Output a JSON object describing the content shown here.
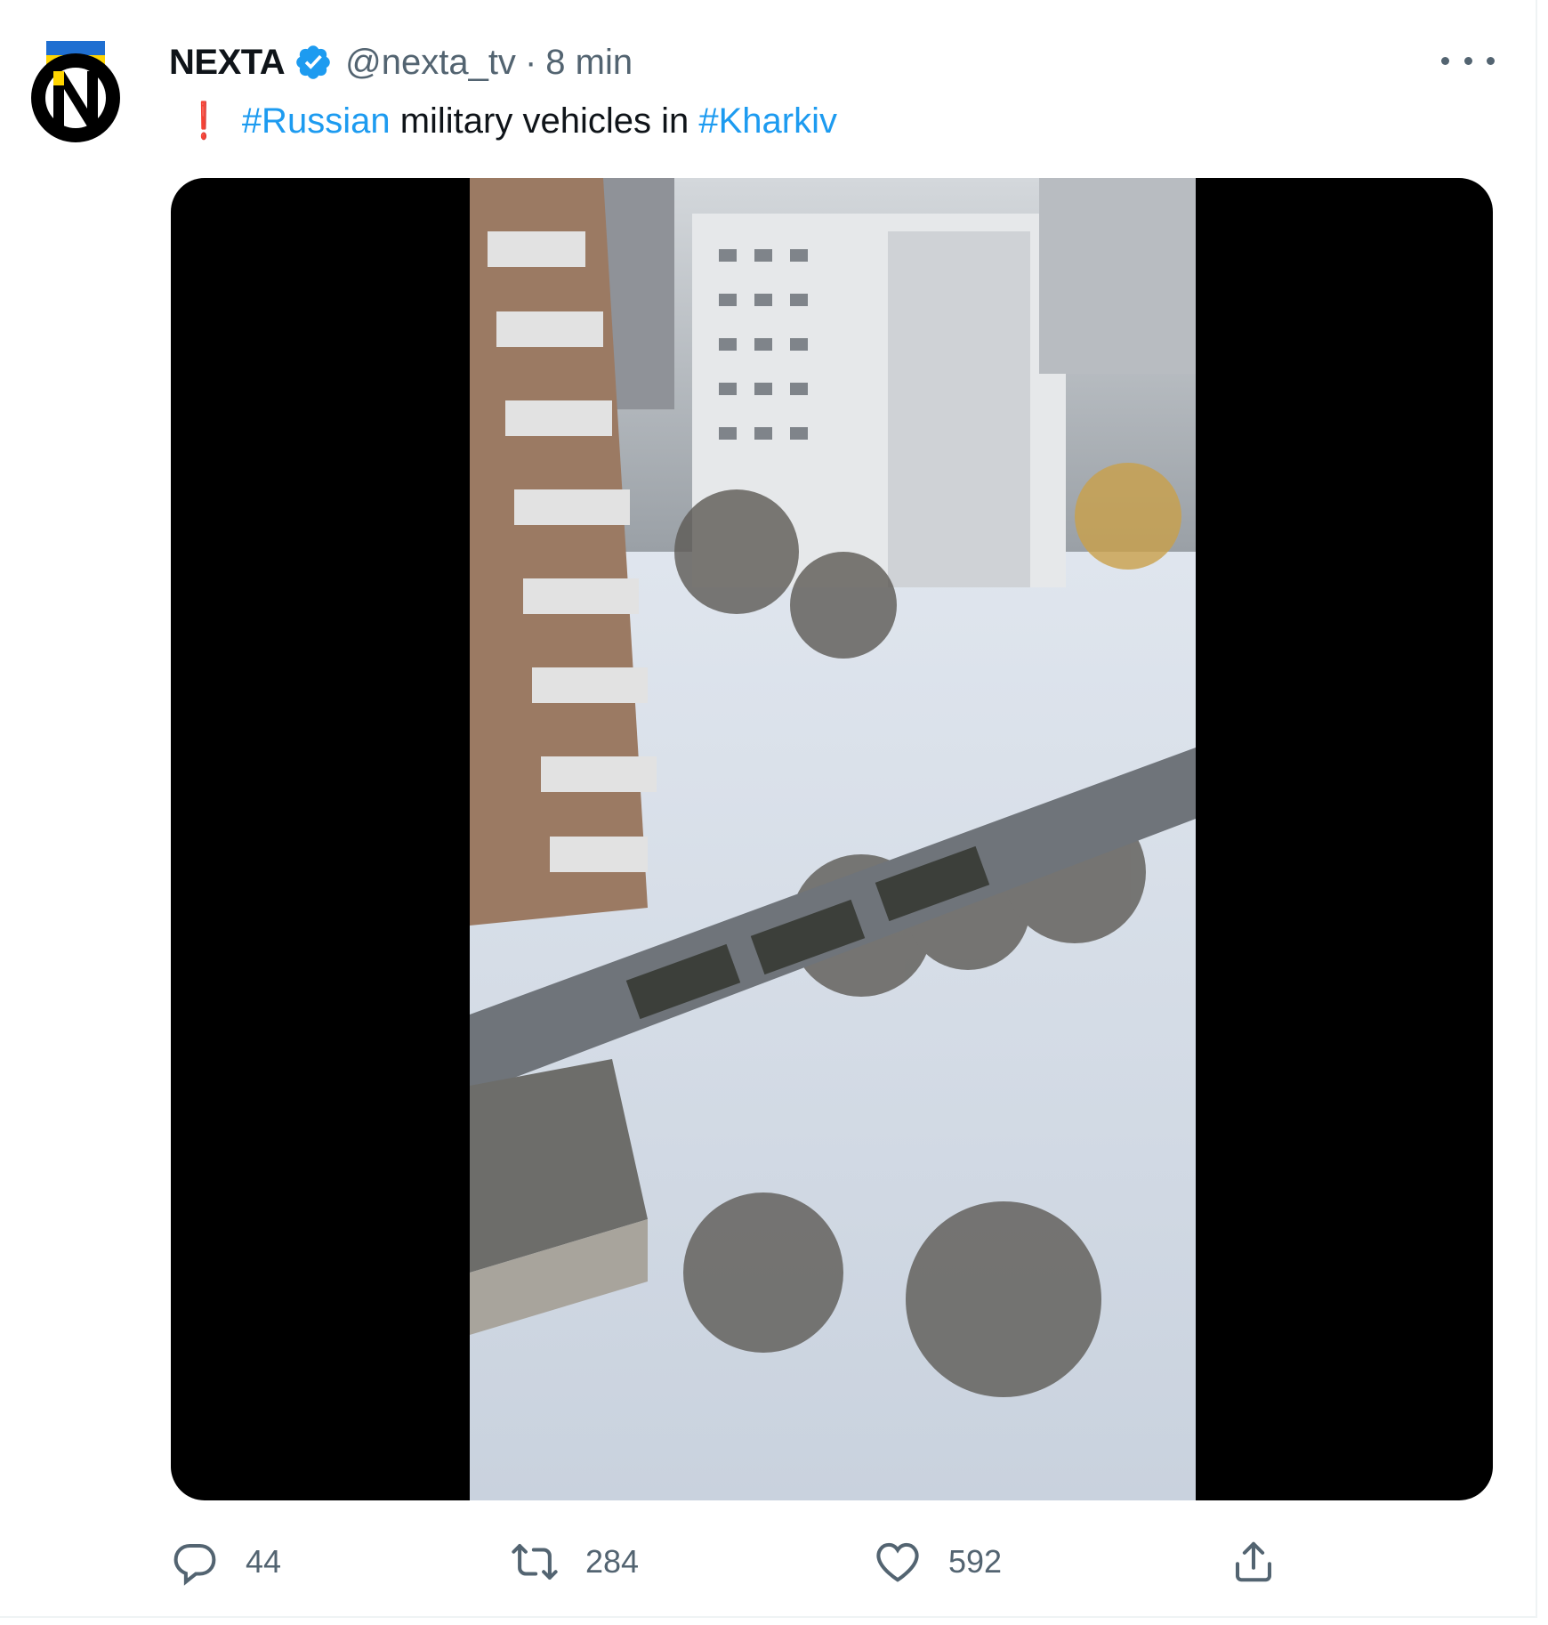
{
  "author": {
    "display_name": "NEXTA",
    "handle": "@nexta_tv",
    "separator": "·",
    "time": "8 min",
    "avatar_letter": "N"
  },
  "tweet": {
    "alert": "❗",
    "hashtag_1": "#Russian",
    "text_middle": " military vehicles in ",
    "hashtag_2": "#Kharkiv"
  },
  "actions": {
    "replies": "44",
    "retweets": "284",
    "likes": "592"
  },
  "colors": {
    "link": "#1d9bf0",
    "secondary": "#536471",
    "verified": "#1d9bf0",
    "flag_blue": "#1f6fd1",
    "flag_yellow": "#ffd500"
  }
}
